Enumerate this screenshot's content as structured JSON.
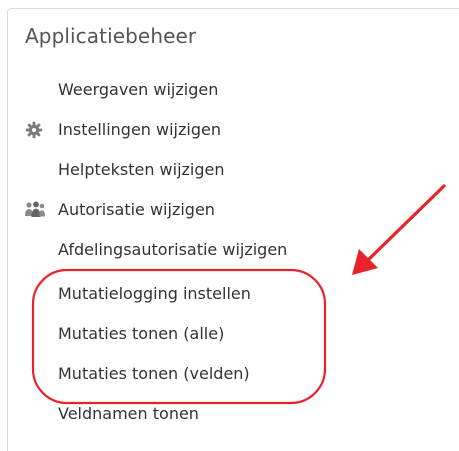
{
  "panel": {
    "title": "Applicatiebeheer"
  },
  "menu": [
    {
      "label": "Weergaven wijzigen",
      "icon": null
    },
    {
      "label": "Instellingen wijzigen",
      "icon": "gear-icon"
    },
    {
      "label": "Helpteksten wijzigen",
      "icon": null
    },
    {
      "label": "Autorisatie wijzigen",
      "icon": "users-icon"
    },
    {
      "label": "Afdelingsautorisatie wijzigen",
      "icon": null
    },
    {
      "label": "Mutatielogging instellen",
      "icon": null
    },
    {
      "label": "Mutaties tonen (alle)",
      "icon": null
    },
    {
      "label": "Mutaties tonen (velden)",
      "icon": null
    },
    {
      "label": "Veldnamen tonen",
      "icon": null
    }
  ],
  "annotation": {
    "color": "#e8242a",
    "shapes": [
      "highlight-ellipse",
      "arrow"
    ]
  }
}
